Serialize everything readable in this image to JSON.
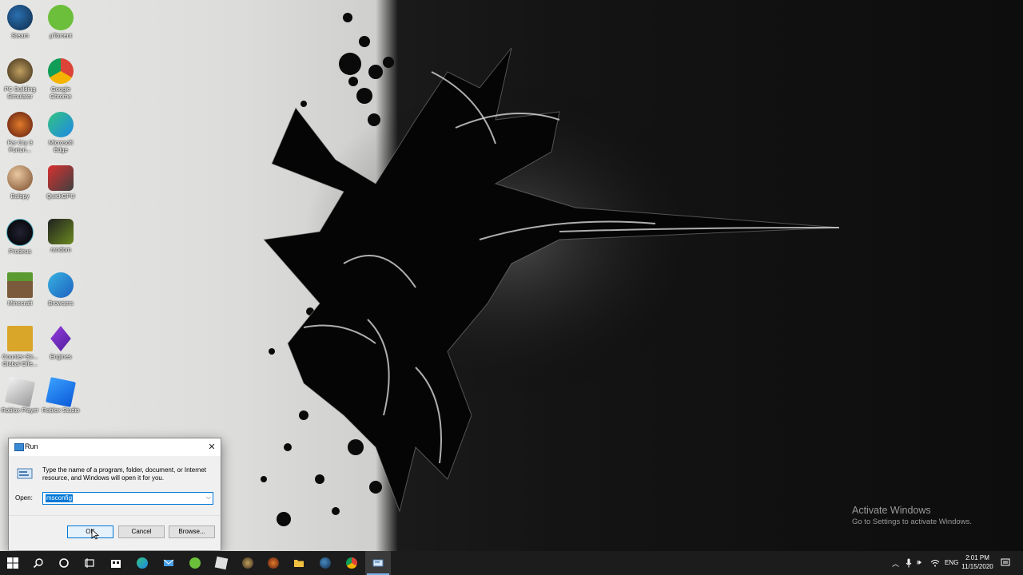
{
  "desktop": {
    "icons": [
      {
        "label": "Steam"
      },
      {
        "label": "µTorrent"
      },
      {
        "label": "PC Building Simulator"
      },
      {
        "label": "Google Chrome"
      },
      {
        "label": "Far Cry 3 Fortun..."
      },
      {
        "label": "Microsoft Edge"
      },
      {
        "label": "Balopy"
      },
      {
        "label": "QuickGPU"
      },
      {
        "label": "Prodeus"
      },
      {
        "label": "random"
      },
      {
        "label": "Minecraft"
      },
      {
        "label": "Browsers"
      },
      {
        "label": "Counter-Str... Global Offe..."
      },
      {
        "label": "Engines"
      },
      {
        "label": "Roblox Player"
      },
      {
        "label": "Roblox Studio"
      }
    ],
    "watermark": {
      "line1": "Activate Windows",
      "line2": "Go to Settings to activate Windows."
    }
  },
  "run_dialog": {
    "title": "Run",
    "description": "Type the name of a program, folder, document, or Internet resource, and Windows will open it for you.",
    "open_label": "Open:",
    "open_value": "msconfig",
    "ok_label": "OK",
    "cancel_label": "Cancel",
    "browse_label": "Browse..."
  },
  "taskbar": {
    "items": [
      "windows-start-icon",
      "search-icon",
      "task-view-icon",
      "task-list-icon",
      "store-icon",
      "edge-icon",
      "mail-icon",
      "utorrent-icon",
      "roblox-icon",
      "pcbs-icon",
      "farcry-icon",
      "file-explorer-icon",
      "steam-icon",
      "chrome-icon",
      "run-icon"
    ],
    "language": "ENG",
    "time": "2:01 PM",
    "date": "11/15/2020"
  },
  "colors": {
    "accent": "#0078d7",
    "taskbar": "#1c1c1c",
    "dialog_bg": "#f0f0f0"
  }
}
